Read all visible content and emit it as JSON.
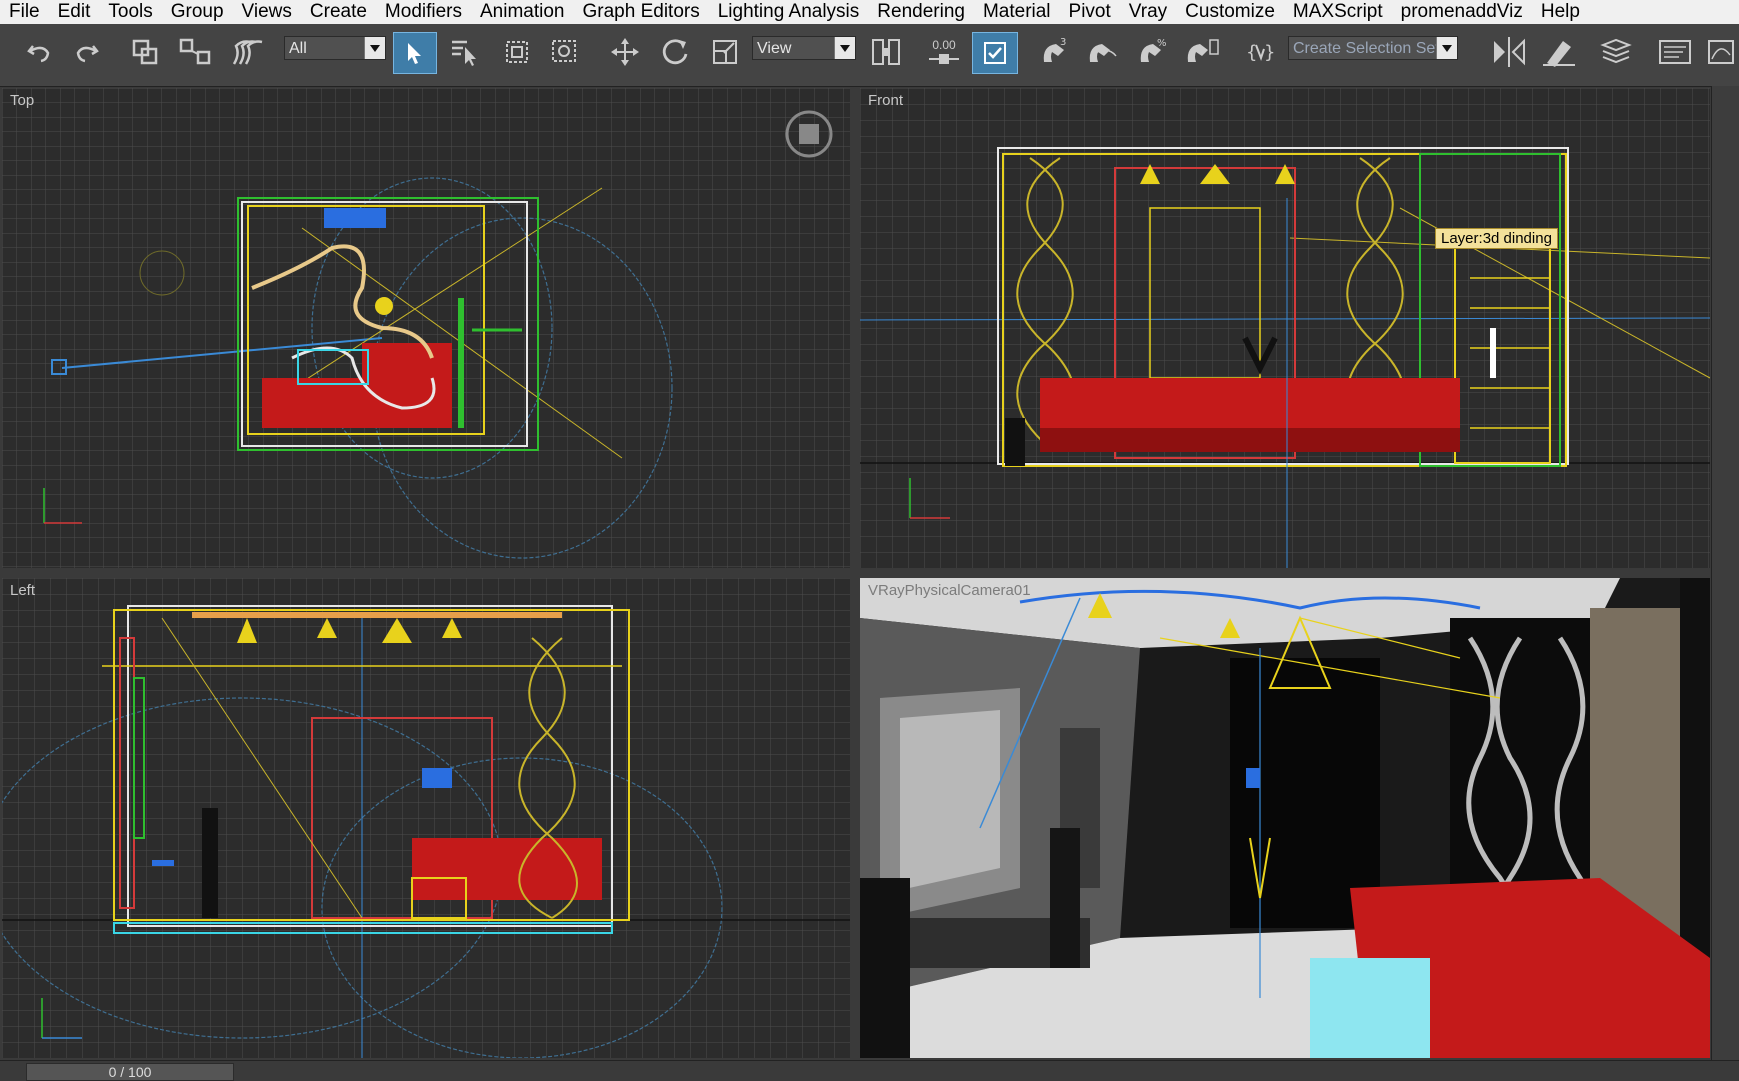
{
  "menu": [
    "File",
    "Edit",
    "Tools",
    "Group",
    "Views",
    "Create",
    "Modifiers",
    "Animation",
    "Graph Editors",
    "Lighting Analysis",
    "Rendering",
    "Material",
    "Pivot",
    "Vray",
    "Customize",
    "MAXScript",
    "promenaddViz",
    "Help"
  ],
  "toolbar": {
    "filter_value": "All",
    "refcoord_value": "View",
    "snap_value": "0.00",
    "selection_set_placeholder": "Create Selection Set"
  },
  "viewports": {
    "top": {
      "label": "Top"
    },
    "front": {
      "label": "Front",
      "tooltip": "Layer:3d dinding"
    },
    "left": {
      "label": "Left"
    },
    "camera": {
      "label": "VRayPhysicalCamera01"
    }
  },
  "timeline": {
    "frame": "0 / 100"
  },
  "icons": [
    "undo-icon",
    "redo-icon",
    "select-link-icon",
    "unlink-icon",
    "bind-space-warp-icon",
    "select-object-icon",
    "select-by-name-icon",
    "rect-region-icon",
    "window-crossing-icon",
    "move-icon",
    "rotate-icon",
    "scale-icon",
    "pivot-icon",
    "keyboard-shortcut-icon",
    "snap-toggle-icon",
    "angle-snap-icon",
    "percent-snap-icon",
    "spinner-snap-icon",
    "named-selection-icon",
    "mirror-icon",
    "align-icon",
    "layer-manager-icon",
    "graphite-icon"
  ],
  "colors": {
    "grid_bg": "#2c2c2c",
    "grid_line": "#4a4a4a",
    "sofa": "#c41a1a",
    "yellow": "#e8d21c",
    "green": "#2fbf2f",
    "white": "#e8e8e8",
    "cyan": "#3ad6e6",
    "active_blue": "#3f7da8"
  }
}
